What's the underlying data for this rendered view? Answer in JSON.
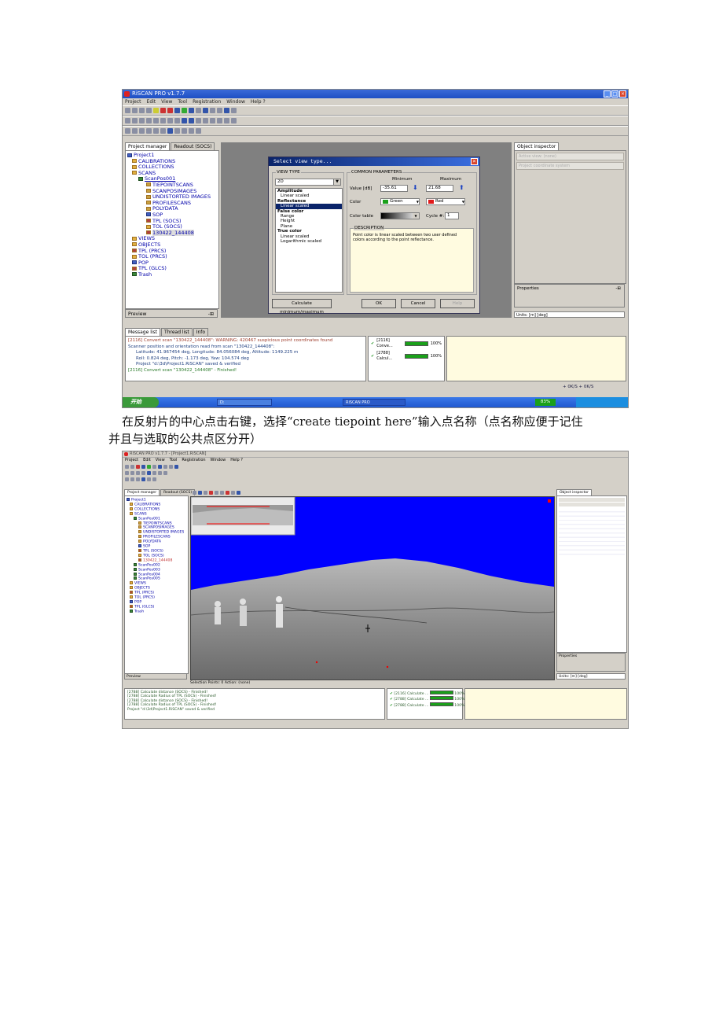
{
  "screenshot1": {
    "app_title": "RiSCAN PRO v1.7.7",
    "menu": [
      "Project",
      "Edit",
      "View",
      "Tool",
      "Registration",
      "Window",
      "Help ?"
    ],
    "left_tabs": [
      "Project manager",
      "Readout (SOCS)"
    ],
    "tree": [
      "Project1",
      "CALIBRATIONS",
      "COLLECTIONS",
      "SCANS",
      "ScanPos001",
      "TIEPOINTSCANS",
      "SCANPOSIMAGES",
      "UNDISTORTED IMAGES",
      "PROFILESCANS",
      "POLYDATA",
      "SOP",
      "TPL (SOCS)",
      "TOL (SOCS)",
      "130422_144408",
      "VIEWS",
      "OBJECTS",
      "TPL (PRCS)",
      "TOL (PRCS)",
      "POP",
      "TPL (GLCS)",
      "Trash"
    ],
    "preview_label": "Preview",
    "preview_pin": "-⊞",
    "right_tab": "Object inspector",
    "inspector_fields": [
      "Active view: (none)",
      "Project coordinate system"
    ],
    "properties_label": "Properties",
    "properties_pin": "-⊞",
    "units_label": "Units: [m] [deg]",
    "dialog": {
      "title": "Select view type...",
      "view_type_label": "VIEW TYPE",
      "view_type_value": "2D",
      "view_list": [
        {
          "text": "Amplitude",
          "kind": "cat"
        },
        {
          "text": "Linear scaled",
          "kind": "item"
        },
        {
          "text": "Reflectance",
          "kind": "cat"
        },
        {
          "text": "Linear scaled",
          "kind": "sel"
        },
        {
          "text": "False color",
          "kind": "cat"
        },
        {
          "text": "Range",
          "kind": "item"
        },
        {
          "text": "Height",
          "kind": "item"
        },
        {
          "text": "Plane",
          "kind": "item"
        },
        {
          "text": "True color",
          "kind": "cat"
        },
        {
          "text": "Linear scaled",
          "kind": "item"
        },
        {
          "text": "Logarithmic scaled",
          "kind": "item"
        }
      ],
      "common_label": "COMMON PARAMETERS",
      "minimum_label": "Minimum",
      "maximum_label": "Maximum",
      "value_label": "Value [dB]",
      "min_value": "-35.61",
      "max_value": "21.68",
      "color_label": "Color",
      "min_color": "Green",
      "max_color": "Red",
      "color_table_label": "Color table",
      "cycle_label": "Cycle #:",
      "cycle_value": "1",
      "description_label": "DESCRIPTION",
      "description": "Point color is linear scaled between two user defined colors according to the point reflectance.",
      "calc_button": "Calculate minimum/maximum",
      "ok_button": "OK",
      "cancel_button": "Cancel",
      "help_button": "Help"
    },
    "message_tabs": [
      "Message list",
      "Thread list",
      "Info"
    ],
    "messages": [
      {
        "text": "[2116] Convert scan \"130422_144408\": WARNING: 420467 suspicious point coordinates found",
        "kind": "warn"
      },
      {
        "text": "Scanner position and orientation read from scan \"130422_144408\":",
        "kind": "info"
      },
      {
        "text": "Latitude: 41.967454 deg, Longitude: 84.056084 deg, Altitude: 1149.225 m",
        "kind": "sub"
      },
      {
        "text": "Roll: 0.824 deg, Pitch: -1.173 deg, Yaw: 104.574 deg",
        "kind": "sub"
      },
      {
        "text": "Project \"d:\\3d\\Project1.RiSCAN\" saved & verified",
        "kind": "sub"
      },
      {
        "text": "[2116] Convert scan \"130422_144408\" - Finished!",
        "kind": "fin"
      }
    ],
    "threads": [
      {
        "label": "[2116] Conve...",
        "pct": "100%"
      },
      {
        "label": "[2788] Calcul...",
        "pct": "100%"
      }
    ],
    "status_right": "+ 0K/S + 0K/S",
    "taskbar": {
      "start": "开始",
      "tasks": [
        "D:",
        "RiSCAN PRO"
      ],
      "battery": "83%"
    }
  },
  "caption_line1": "在反射片的中心点击右键，选择“create tiepoint here”输入点名称（点名称应便于记住",
  "caption_line2": "并且与选取的公共点区分开）",
  "screenshot2": {
    "app_title": "RiSCAN PRO v1.7.7 - [Project1.RiSCAN]",
    "menu": [
      "Project",
      "Edit",
      "View",
      "Tool",
      "Registration",
      "Window",
      "Help ?"
    ],
    "left_tabs": [
      "Project manager",
      "Readout (SOCS)"
    ],
    "tree": [
      "Project1",
      "CALIBRATIONS",
      "COLLECTIONS",
      "SCANS",
      "ScanPos001",
      "TIEPOINTSCANS",
      "SCANPOSIMAGES",
      "UNDISTORTED IMAGES",
      "PROFILESCANS",
      "POLYDATA",
      "SOP",
      "TPL (SOCS)",
      "TOL (SOCS)",
      "130422_144408",
      "ScanPos002",
      "ScanPos003",
      "ScanPos004",
      "ScanPos005",
      "VIEWS",
      "OBJECTS",
      "TPL (PRCS)",
      "TOL (PRCS)",
      "POP",
      "TPL (GLCS)",
      "Trash"
    ],
    "preview_label": "Preview",
    "right_tab": "Object inspector",
    "properties_label": "Properties",
    "status_bar": "Selection   Points: 0   Action: (none)",
    "units": "Units: [m] [deg]",
    "messages": [
      "[2788] Calculate distance (SOCS) - Finished!",
      "[2788] Calculate Radius of TPL (SOCS) - Finished!",
      "[2788] Calculate distance (SOCS) - Finished!",
      "[2788] Calculate Radius of TPL (SOCS) - Finished!",
      "Project \"d:\\3d\\Project1.RiSCAN\" saved & verified"
    ],
    "threads": [
      {
        "label": "[2116] Calculate ...",
        "pct": "100%"
      },
      {
        "label": "[2788] Calculate ...",
        "pct": "100%"
      },
      {
        "label": "[2788] Calculate ...",
        "pct": "100%"
      }
    ]
  }
}
